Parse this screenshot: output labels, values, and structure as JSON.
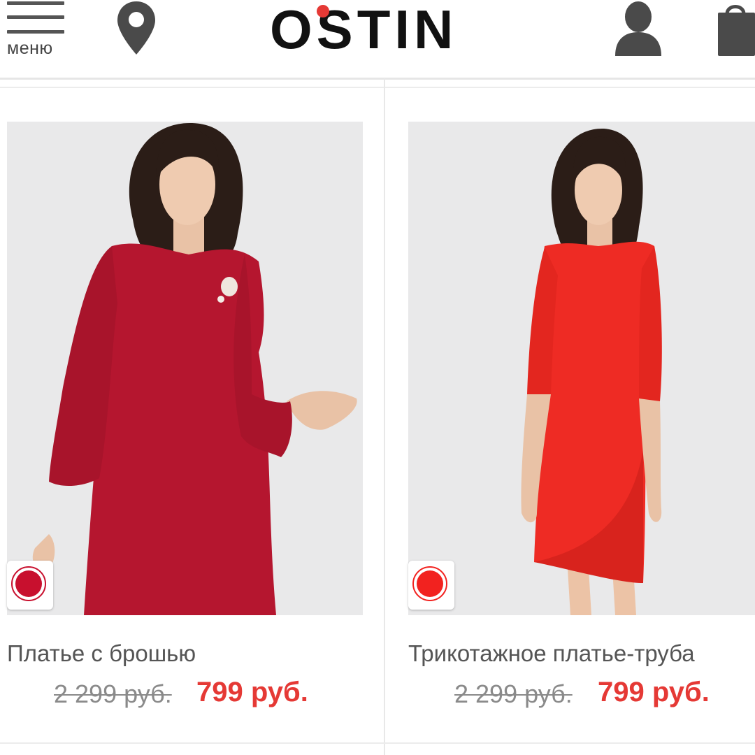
{
  "header": {
    "menu_label": "меню",
    "logo_text": "OSTIN",
    "icons": {
      "menu": "hamburger-icon",
      "location": "location-pin-icon",
      "account": "user-icon",
      "cart": "shopping-bag-icon"
    }
  },
  "colors": {
    "brand_red": "#e53935",
    "price_red": "#e53935",
    "icon_gray": "#4a4a4a",
    "photo_bg": "#e9e9ea"
  },
  "products": [
    {
      "name": "Платье с брошью",
      "old_price": "2 299 руб.",
      "new_price": "799 руб.",
      "swatch_color": "#c8102e"
    },
    {
      "name": "Трикотажное платье-труба",
      "old_price": "2 299 руб.",
      "new_price": "799 руб.",
      "swatch_color": "#f2221f"
    }
  ]
}
